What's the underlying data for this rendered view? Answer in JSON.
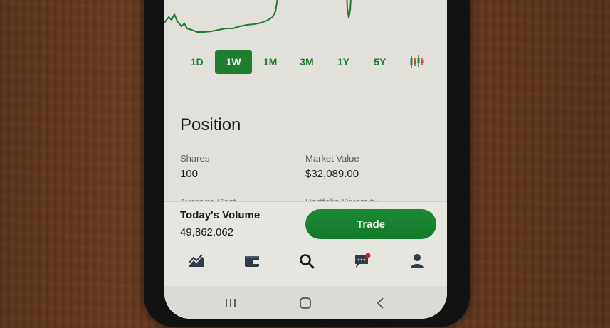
{
  "chart_icon_color": "#1f7a33",
  "accent": "#1f7d2e",
  "ranges": [
    "1D",
    "1W",
    "1M",
    "3M",
    "1Y",
    "5Y"
  ],
  "active_range": "1W",
  "position": {
    "title": "Position",
    "shares_label": "Shares",
    "shares_value": "100",
    "market_value_label": "Market Value",
    "market_value_value": "$32,089.00",
    "average_cost_label": "Average Cost",
    "portfolio_diversity_label": "Portfolio Diversity"
  },
  "bottom": {
    "volume_label": "Today's Volume",
    "volume_value": "49,862,062",
    "trade_label": "Trade"
  },
  "tabs": [
    "chart-icon",
    "wallet-icon",
    "search-icon",
    "chat-icon",
    "profile-icon"
  ],
  "system_nav": [
    "recents-icon",
    "home-icon",
    "back-icon"
  ]
}
